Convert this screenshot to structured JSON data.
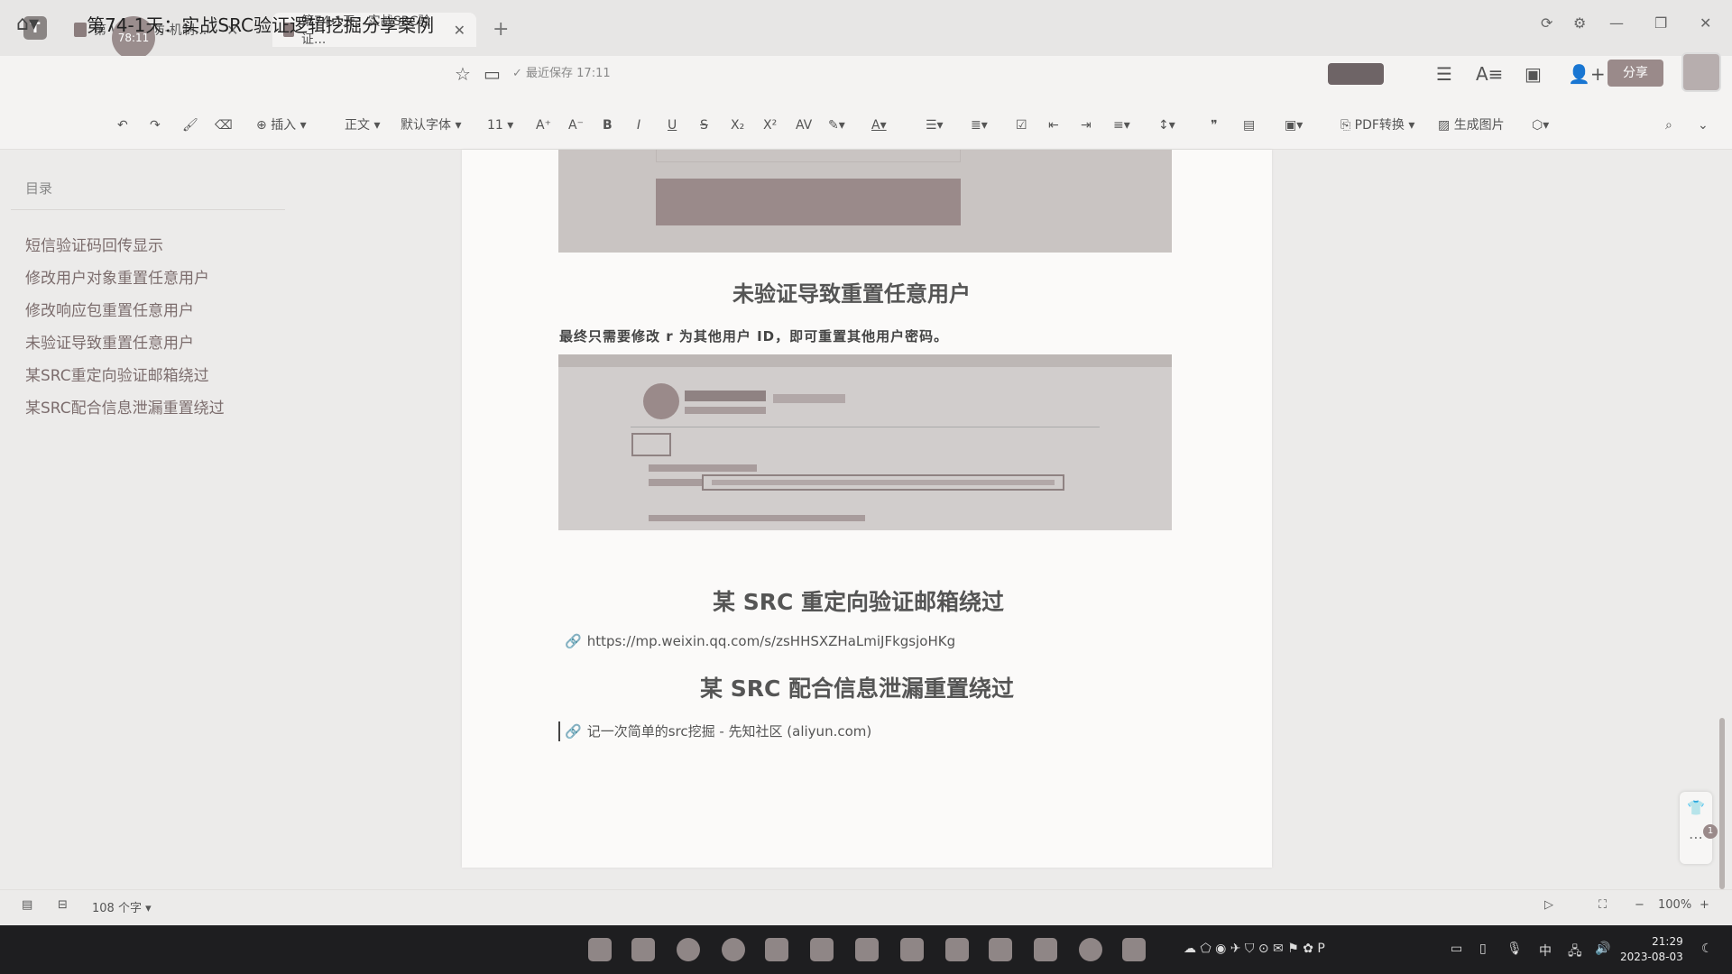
{
  "tabs": [
    {
      "label": "第 WEB攻防-机制..."
    },
    {
      "label": "第74-1天：实战SRC验证..."
    }
  ],
  "recording_badge": "78:11",
  "doc": {
    "title": "第74-1天：实战SRC验证逻辑挖掘分享案例",
    "save_status": "最近保存 17:11"
  },
  "share_label": "分享",
  "toolbar": {
    "insert": "插入",
    "style": "正文",
    "font": "默认字体",
    "font_size": "11",
    "pdf_convert": "PDF转换",
    "gen_image": "生成图片"
  },
  "toc": {
    "header": "目录",
    "items": [
      {
        "label": "短信验证码回传显示"
      },
      {
        "label": "修改用户对象重置任意用户"
      },
      {
        "label": "修改响应包重置任意用户"
      },
      {
        "label": "未验证导致重置任意用户"
      },
      {
        "label": "某SRC重定向验证邮箱绕过"
      },
      {
        "label": "某SRC配合信息泄漏重置绕过"
      }
    ]
  },
  "content": {
    "heading1": "未验证导致重置任意用户",
    "paragraph1": "最终只需要修改 r 为其他用户 ID，即可重置其他用户密码。",
    "heading2": "某 SRC 重定向验证邮箱绕过",
    "link1": "https://mp.weixin.qq.com/s/zsHHSXZHaLmiJFkgsjoHKg",
    "heading3": "某 SRC 配合信息泄漏重置绕过",
    "link2": "记一次简单的src挖掘 - 先知社区 (aliyun.com)"
  },
  "status": {
    "word_count": "108 个字",
    "zoom": "100%"
  },
  "taskbar": {
    "ime": "中",
    "time": "21:29",
    "date": "2023-08-03"
  },
  "float_badge": "1"
}
